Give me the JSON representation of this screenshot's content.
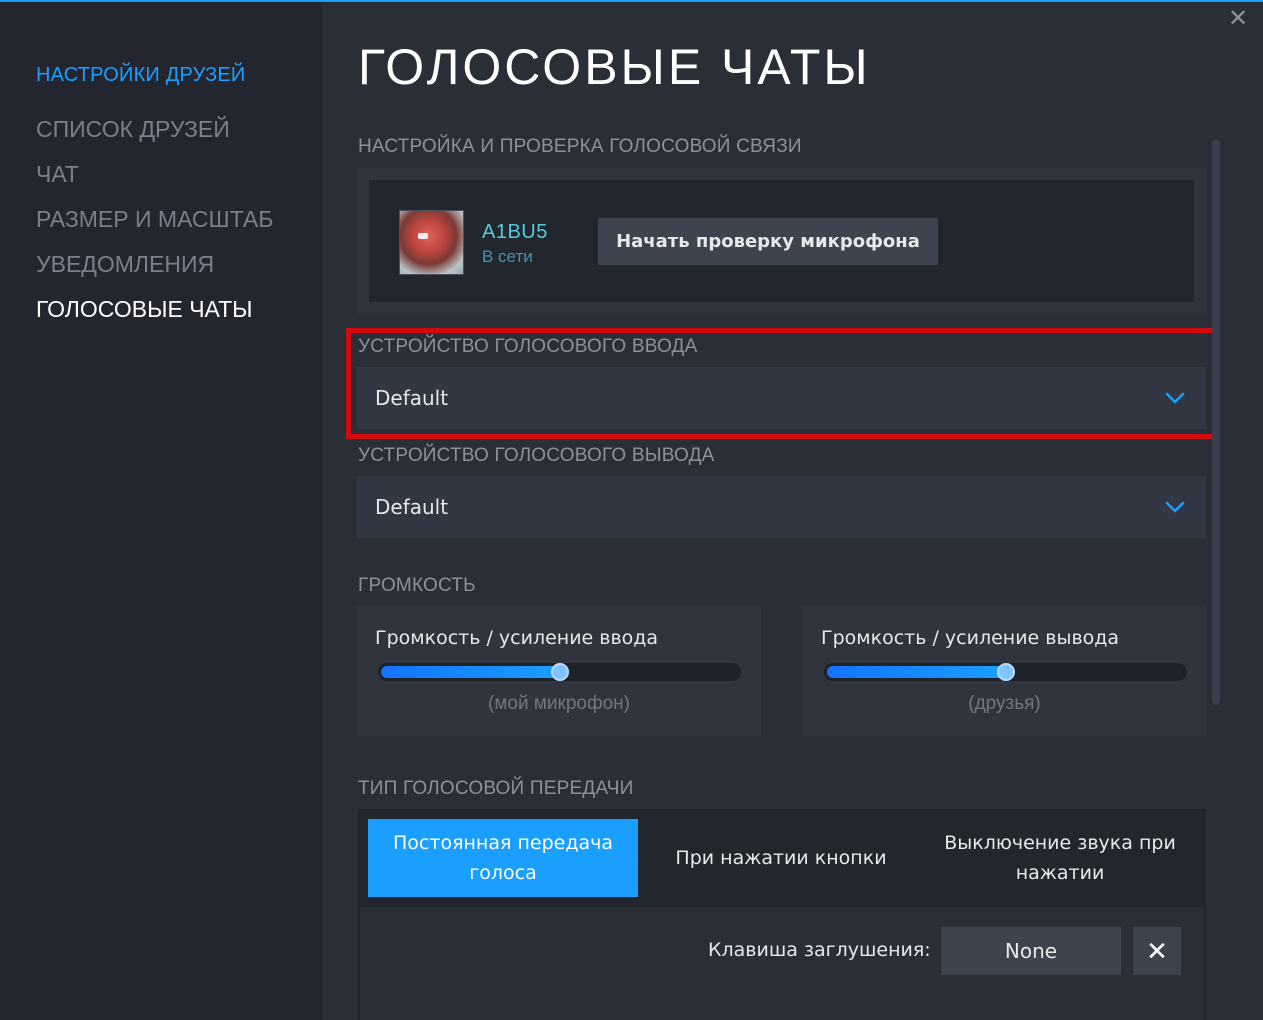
{
  "window": {
    "close_glyph": "✕",
    "accent": "#1a9fff"
  },
  "sidebar": {
    "header": "НАСТРОЙКИ ДРУЗЕЙ",
    "items": [
      {
        "label": "СПИСОК ДРУЗЕЙ",
        "active": false
      },
      {
        "label": "ЧАТ",
        "active": false
      },
      {
        "label": "РАЗМЕР И МАСШТАБ",
        "active": false
      },
      {
        "label": "УВЕДОМЛЕНИЯ",
        "active": false
      },
      {
        "label": "ГОЛОСОВЫЕ ЧАТЫ",
        "active": true
      }
    ]
  },
  "page": {
    "title": "ГОЛОСОВЫЕ ЧАТЫ"
  },
  "voice_test": {
    "section_label": "НАСТРОЙКА И ПРОВЕРКА ГОЛОСОВОЙ СВЯЗИ",
    "user": {
      "name": "A1BU5",
      "status": "В сети"
    },
    "button": "Начать проверку микрофона"
  },
  "input_device": {
    "section_label": "УСТРОЙСТВО ГОЛОСОВОГО ВВОДА",
    "value": "Default",
    "highlighted": true,
    "highlight_color": "#d2090d"
  },
  "output_device": {
    "section_label": "УСТРОЙСТВО ГОЛОСОВОГО ВЫВОДА",
    "value": "Default"
  },
  "volume": {
    "section_label": "ГРОМКОСТЬ",
    "input": {
      "title": "Громкость / усиление ввода",
      "sublabel": "(мой микрофон)",
      "level": 0.5
    },
    "output": {
      "title": "Громкость / усиление вывода",
      "sublabel": "(друзья)",
      "level": 0.5
    }
  },
  "transmission": {
    "section_label": "ТИП ГОЛОСОВОЙ ПЕРЕДАЧИ",
    "options": [
      {
        "label": "Постоянная передача голоса",
        "active": true
      },
      {
        "label": "При нажатии кнопки",
        "active": false
      },
      {
        "label": "Выключение звука при нажатии",
        "active": false
      }
    ],
    "mute_key_label": "Клавиша заглушения:",
    "mute_key_value": "None",
    "clear_glyph": "✕"
  }
}
